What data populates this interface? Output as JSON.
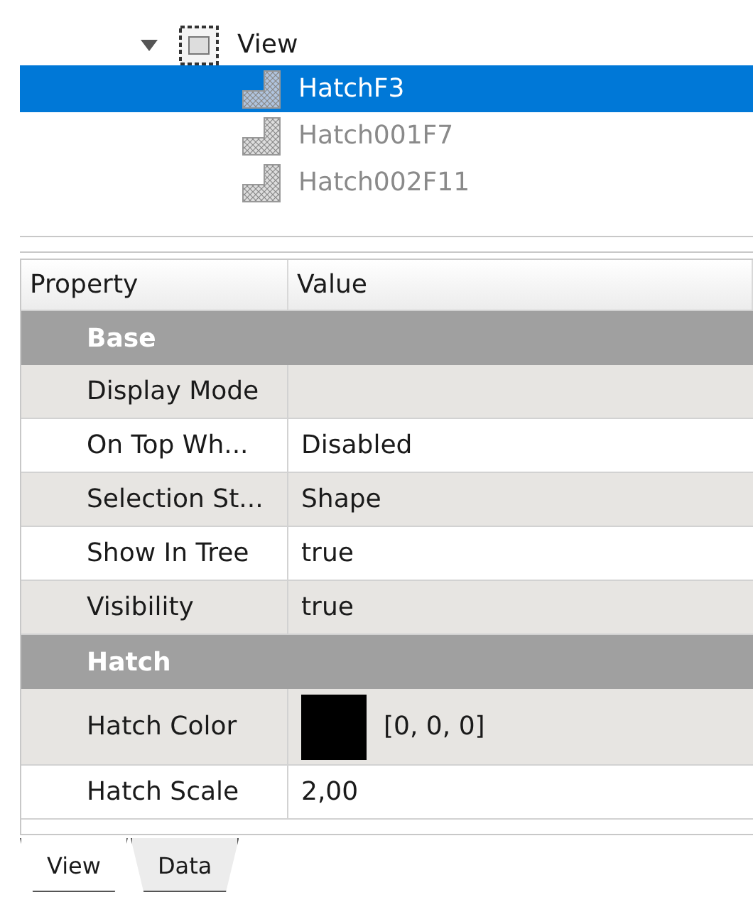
{
  "tree": {
    "label": "View",
    "expanded": true,
    "children": [
      {
        "label": "HatchF3",
        "selected": true,
        "hidden": false
      },
      {
        "label": "Hatch001F7",
        "selected": false,
        "hidden": true
      },
      {
        "label": "Hatch002F11",
        "selected": false,
        "hidden": true
      }
    ]
  },
  "property_table": {
    "columns": [
      "Property",
      "Value"
    ],
    "rows": [
      {
        "kind": "group",
        "name": "Base"
      },
      {
        "kind": "property",
        "name": "Display Mode",
        "value": ""
      },
      {
        "kind": "property",
        "name": "On Top Wh...",
        "value": "Disabled"
      },
      {
        "kind": "property",
        "name": "Selection St...",
        "value": "Shape"
      },
      {
        "kind": "property",
        "name": "Show In Tree",
        "value": "true"
      },
      {
        "kind": "property",
        "name": "Visibility",
        "value": "true"
      },
      {
        "kind": "group",
        "name": "Hatch"
      },
      {
        "kind": "color",
        "name": "Hatch Color",
        "value": "[0, 0, 0]",
        "color": "#000000"
      },
      {
        "kind": "property",
        "name": "Hatch Scale",
        "value": "2,00"
      }
    ]
  },
  "tabs": [
    {
      "label": "View",
      "selected": true
    },
    {
      "label": "Data",
      "selected": false
    }
  ]
}
